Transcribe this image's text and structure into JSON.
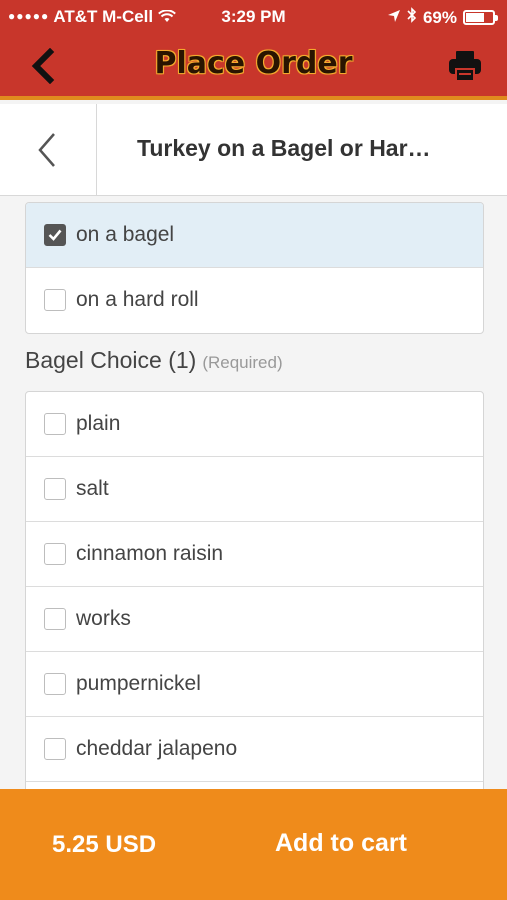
{
  "status_bar": {
    "signal": "●●●●●",
    "carrier": "AT&T M-Cell",
    "time": "3:29 PM",
    "battery_percent": "69%",
    "battery_level": 0.69
  },
  "header": {
    "title": "Place Order",
    "back_icon": "chevron-left-icon",
    "print_icon": "printer-icon"
  },
  "item": {
    "title": "Turkey on a Bagel or Har…"
  },
  "bread_options": [
    {
      "label": "on a bagel",
      "checked": true
    },
    {
      "label": "on a hard roll",
      "checked": false
    }
  ],
  "bagel_choice": {
    "heading": "Bagel Choice (1)",
    "required": "(Required)",
    "options": [
      {
        "label": "plain",
        "checked": false
      },
      {
        "label": "salt",
        "checked": false
      },
      {
        "label": "cinnamon raisin",
        "checked": false
      },
      {
        "label": "works",
        "checked": false
      },
      {
        "label": "pumpernickel",
        "checked": false
      },
      {
        "label": "cheddar jalapeno",
        "checked": false
      }
    ]
  },
  "footer": {
    "price": "5.25 USD",
    "add_to_cart": "Add to cart"
  },
  "colors": {
    "header_red": "#c8362b",
    "accent_orange": "#ef8b1b",
    "selected_row": "#e2eef6"
  }
}
